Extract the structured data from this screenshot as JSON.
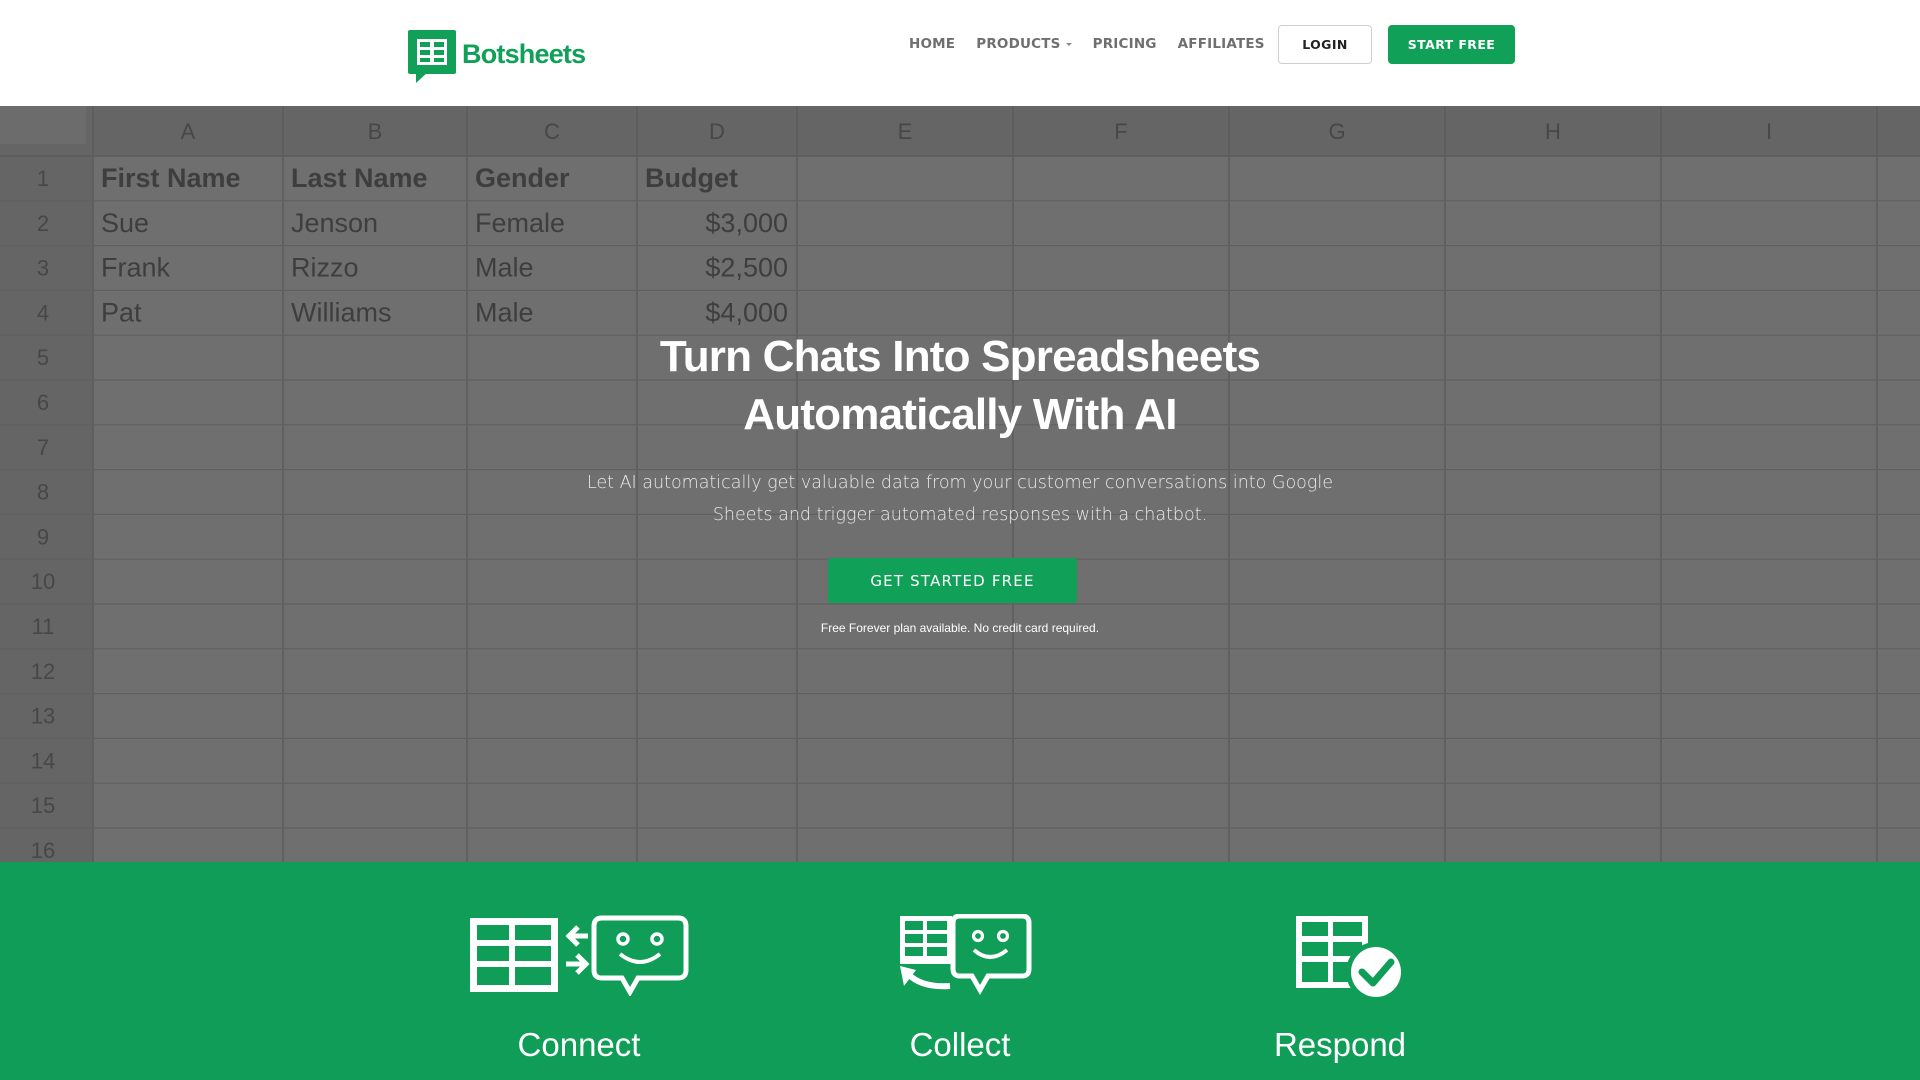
{
  "brand": {
    "name": "Botsheets",
    "accent_color": "#10a058",
    "feature_band_color": "#0f9d57"
  },
  "header": {
    "nav": [
      {
        "label": "HOME"
      },
      {
        "label": "PRODUCTS",
        "has_dropdown": true
      },
      {
        "label": "PRICING"
      },
      {
        "label": "AFFILIATES"
      }
    ],
    "login_label": "LOGIN",
    "start_label": "START FREE"
  },
  "hero": {
    "title_line1": "Turn Chats Into Spreadsheets",
    "title_line2": "Automatically With AI",
    "subtitle_line1": "Let AI automatically get valuable data from your customer conversations into Google",
    "subtitle_line2": "Sheets and trigger automated responses with a chatbot.",
    "cta_label": "GET STARTED FREE",
    "note": "Free Forever plan available. No credit card required."
  },
  "spreadsheet": {
    "columns": [
      "A",
      "B",
      "C",
      "D",
      "E",
      "F",
      "G",
      "H",
      "I"
    ],
    "row_numbers": [
      "1",
      "2",
      "3",
      "4",
      "5",
      "6",
      "7",
      "8",
      "9",
      "10",
      "11",
      "12",
      "13",
      "14",
      "15",
      "16"
    ],
    "header_row": [
      "First Name",
      "Last Name",
      "Gender",
      "Budget"
    ],
    "rows": [
      [
        "Sue",
        "Jenson",
        "Female",
        "$3,000"
      ],
      [
        "Frank",
        "Rizzo",
        "Male",
        "$2,500"
      ],
      [
        "Pat",
        "Williams",
        "Male",
        "$4,000"
      ]
    ]
  },
  "features": [
    {
      "label": "Connect",
      "icon": "sheet-chat-sync-icon"
    },
    {
      "label": "Collect",
      "icon": "sheet-chat-collect-icon"
    },
    {
      "label": "Respond",
      "icon": "sheet-check-icon"
    }
  ]
}
